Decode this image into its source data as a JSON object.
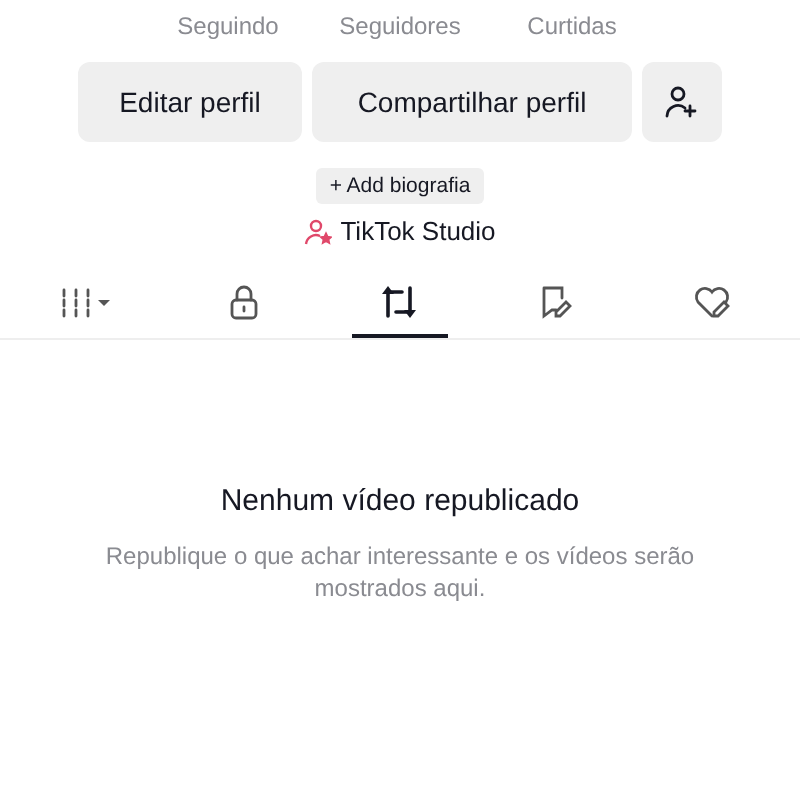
{
  "stats": [
    {
      "label": "Seguindo"
    },
    {
      "label": "Seguidores"
    },
    {
      "label": "Curtidas"
    }
  ],
  "actions": [
    {
      "kind": "text",
      "label": "Editar perfil"
    },
    {
      "kind": "text",
      "label": "Compartilhar perfil"
    },
    {
      "kind": "add-friend"
    }
  ],
  "bio_button": "+ Add biografia",
  "studio_link": "TikTok Studio",
  "tabs": [
    {
      "kind": "grid",
      "selected": false
    },
    {
      "kind": "lock",
      "selected": false
    },
    {
      "kind": "repost",
      "selected": true
    },
    {
      "kind": "tagged",
      "selected": false
    },
    {
      "kind": "liked",
      "selected": false
    }
  ],
  "empty": {
    "title": "Nenhum vídeo republicado",
    "message": "Republique o que achar interessante e os vídeos serão mostrados aqui."
  }
}
